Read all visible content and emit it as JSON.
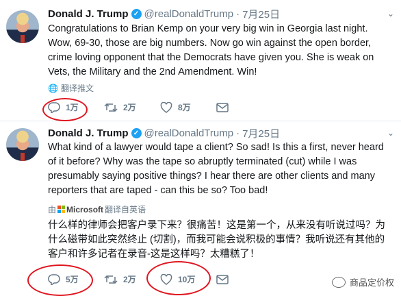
{
  "tweets": [
    {
      "name": "Donald J. Trump",
      "handle": "@realDonaldTrump",
      "separator": "·",
      "date": "7月25日",
      "text": "Congratulations to Brian Kemp on your very big win in Georgia last night. Wow, 69-30, those are big numbers. Now go win against the open border, crime loving opponent that the Democrats have given you. She is weak on Vets, the Military and the 2nd Amendment. Win!",
      "translate_link": "翻译推文",
      "replies": "1万",
      "retweets": "2万",
      "likes": "8万"
    },
    {
      "name": "Donald J. Trump",
      "handle": "@realDonaldTrump",
      "separator": "·",
      "date": "7月25日",
      "text": "What kind of a lawyer would tape a client? So sad! Is this a first, never heard of it before? Why was the tape so abruptly terminated (cut) while I was presumably saying positive things? I hear there are other clients and many reporters that are taped - can this be so? Too bad!",
      "translated_by_prefix": "由",
      "translated_by_name": "Microsoft",
      "translated_by_suffix": "翻译自英语",
      "translation": "什么样的律师会把客户录下来？很痛苦！这是第一个，从来没有听说过吗？为什么磁带如此突然终止 (切割)，而我可能会说积极的事情？我听说还有其他的客户和许多记者在录音-这是这样吗？太糟糕了！",
      "replies": "5万",
      "retweets": "2万",
      "likes": "10万"
    }
  ],
  "watermark": "商品定价权",
  "icons": {
    "verified": "verified-badge-icon",
    "menu": "chevron-down-icon",
    "globe": "globe-icon",
    "reply": "reply-icon",
    "retweet": "retweet-icon",
    "like": "heart-icon",
    "dm": "envelope-icon"
  },
  "colors": {
    "accent": "#1da1f2",
    "annotation": "#e0141e",
    "muted": "#657786"
  }
}
